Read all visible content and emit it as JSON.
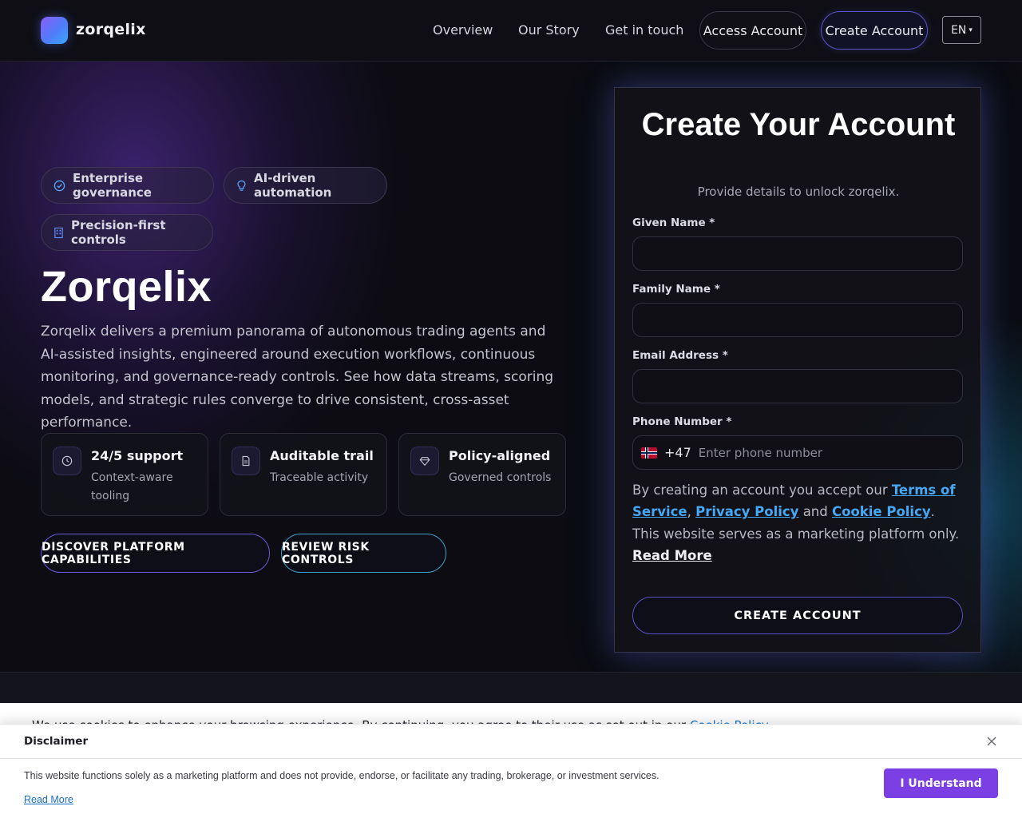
{
  "header": {
    "brand": "zorqelix",
    "nav": [
      "Overview",
      "Our Story",
      "Get in touch"
    ],
    "access_label": "Access Account",
    "create_label": "Create Account",
    "lang": "EN",
    "lang_caret": "▾"
  },
  "hero": {
    "chips": [
      {
        "label": "Enterprise governance",
        "icon": "check-circle-icon"
      },
      {
        "label": "AI-driven automation",
        "icon": "lightbulb-icon"
      },
      {
        "label": "Precision-first controls",
        "icon": "grid-icon"
      }
    ],
    "title": "Zorqelix",
    "description": "Zorqelix delivers a premium panorama of autonomous trading agents and AI-assisted insights, engineered around execution workflows, continuous monitoring, and governance-ready controls. See how data streams, scoring models, and strategic rules converge to drive consistent, cross-asset performance.",
    "features": [
      {
        "title": "24/5 support",
        "subtitle": "Context-aware tooling",
        "icon": "clock-icon"
      },
      {
        "title": "Auditable trail",
        "subtitle": "Traceable activity",
        "icon": "document-icon"
      },
      {
        "title": "Policy-aligned",
        "subtitle": "Governed controls",
        "icon": "diamond-icon"
      }
    ],
    "btn_primary": "DISCOVER PLATFORM CAPABILITIES",
    "btn_secondary": "REVIEW RISK CONTROLS"
  },
  "form": {
    "title": "Create Your Account",
    "subtitle": "Provide details to unlock zorqelix.",
    "given_label": "Given Name *",
    "family_label": "Family Name *",
    "email_label": "Email Address *",
    "phone_label": "Phone Number *",
    "dial_code": "+47",
    "phone_placeholder": "Enter phone number",
    "consent_pre": "By creating an account you accept our ",
    "terms": "Terms of Service",
    "comma": ", ",
    "privacy": "Privacy Policy",
    "and": " and ",
    "cookie": "Cookie Policy",
    "consent_post": ". This website serves as a marketing platform only. ",
    "read_more": "Read More",
    "submit": "CREATE ACCOUNT"
  },
  "cookie_peek": {
    "text": "We use cookies to enhance your browsing experience. By continuing, you agree to their use as set out in our",
    "link": "Cookie Policy",
    "tail": "."
  },
  "disclaimer": {
    "title": "Disclaimer",
    "text": "This website functions solely as a marketing platform and does not provide, endorse, or facilitate any trading, brokerage, or investment services.",
    "link": "Read More",
    "button": "I Understand"
  },
  "colors": {
    "accent_purple": "#7b3fe4",
    "link_blue": "#46a8f4",
    "background": "#0c0c12"
  }
}
